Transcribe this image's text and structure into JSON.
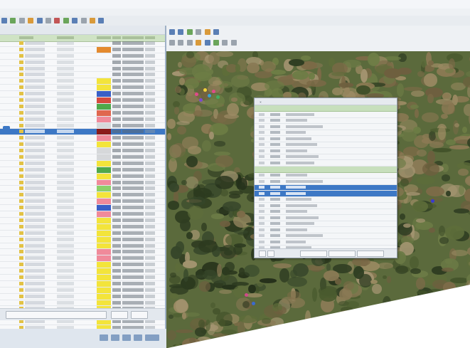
{
  "colors": {
    "selection": "#3d78c5",
    "table_header_green": "#cfe3c4",
    "dialog_header_green": "#c7dfbc",
    "panel_divider": "#9fb1c6"
  },
  "icons": {
    "toolbar": [
      "open-icon",
      "save-icon",
      "zoom-icon",
      "pan-icon",
      "select-icon",
      "layers-icon",
      "settings-icon"
    ],
    "map_markers": [
      "marker-icon"
    ]
  },
  "table": {
    "row_colors": [
      "",
      "#e48a2e",
      "",
      "",
      "",
      "",
      "#f3e43b",
      "#f3e43b",
      "#3a5fc6",
      "#d64a3e",
      "#4fa84a",
      "#e0674f",
      "#f08a9a",
      "#d6d8da",
      "#8b1b1b",
      "#f08a9a",
      "#f3e43b",
      "#d6d8da",
      "#d6d8da",
      "#f3e43b",
      "#4fa84a",
      "#f3e43b",
      "#f08a9a",
      "#8bd06a",
      "#f3e43b",
      "#f08a9a",
      "#3a5fc6",
      "#f08a9a",
      "#f3e43b",
      "#f3e43b",
      "#f3e43b",
      "#f3e43b",
      "#f3e43b",
      "#f08a9a",
      "#f08a9a",
      "#f3e43b",
      "#f3e43b",
      "#f3e43b",
      "#f3e43b",
      "#f3e43b",
      "#f3e43b",
      "#f3e43b",
      "#f3e43b",
      "#f3e43b",
      "#f3e43b",
      "#f3e43b",
      "#f3e43b",
      "#f3e43b"
    ],
    "selected_row": 14
  },
  "dialog": {
    "selected_row": 12
  }
}
